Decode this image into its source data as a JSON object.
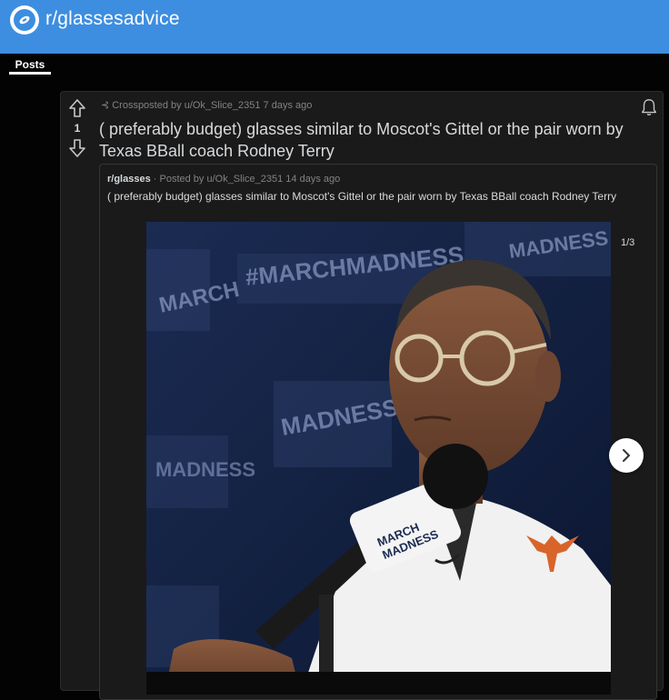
{
  "header": {
    "title": "r/glassesadvice"
  },
  "tabs": [
    {
      "label": "Posts"
    }
  ],
  "post": {
    "vote_count": "1",
    "crosspost_meta": "Crossposted by u/Ok_Slice_2351 7 days ago",
    "title": "( preferably budget) glasses similar to Moscot's Gittel or the pair worn by Texas BBall coach Rodney Terry",
    "embed": {
      "subreddit": "r/glasses",
      "posted_by": "· Posted by u/Ok_Slice_2351 14 days ago",
      "title": "( preferably budget) glasses similar to Moscot's Gittel or the pair worn by Texas BBall coach Rodney Terry",
      "gallery_counter": "1/3",
      "backdrop_text": [
        "MARCH",
        "MADNESS",
        "#MARCHMADNESS"
      ],
      "mic_text": [
        "MARCH",
        "MADNESS"
      ]
    }
  },
  "colors": {
    "brand": "#3d8ee0",
    "background": "#030303",
    "card": "#1a1a1b",
    "logo_orange": "#d9642a"
  }
}
